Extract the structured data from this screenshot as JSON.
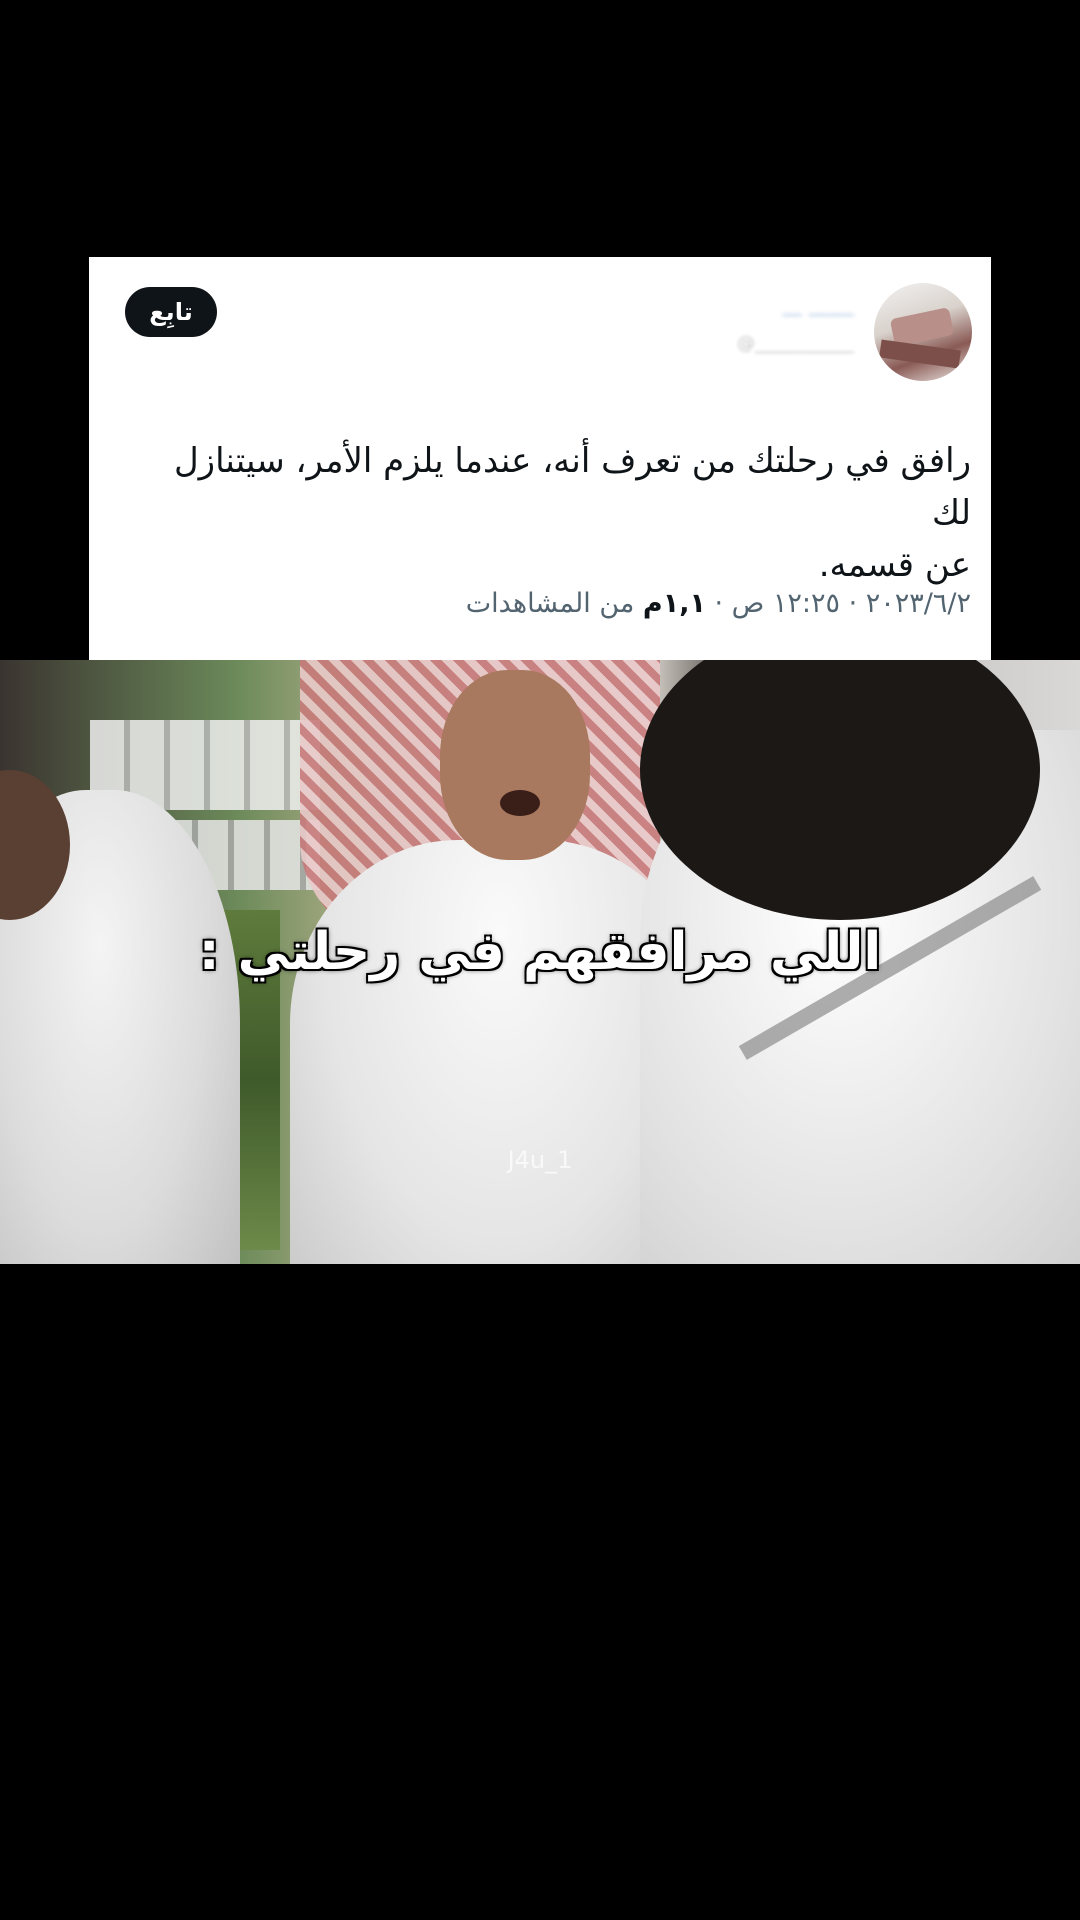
{
  "tweet": {
    "follow_label": "تابِع",
    "display_name": "ـــــــ ـــ",
    "handle": "@___________",
    "text_line1": "رافق في رحلتك من تعرف أنه، عندما يلزم الأمر، سيتنازل لك",
    "text_line2": "عن قسمه.",
    "meta_date_time": "٢٠٢٣/٦/٢ · ١٢:٢٥ ص · ",
    "meta_views_count": "١,١م",
    "meta_views_label": " من المشاهدات"
  },
  "video": {
    "caption": "اللي مرافقهم في رحلتي :",
    "watermark": "J4u_1"
  },
  "colors": {
    "background": "#000000",
    "card": "#ffffff",
    "follow_button": "#0f1419",
    "text_primary": "#0f1419",
    "text_secondary": "#536471"
  }
}
